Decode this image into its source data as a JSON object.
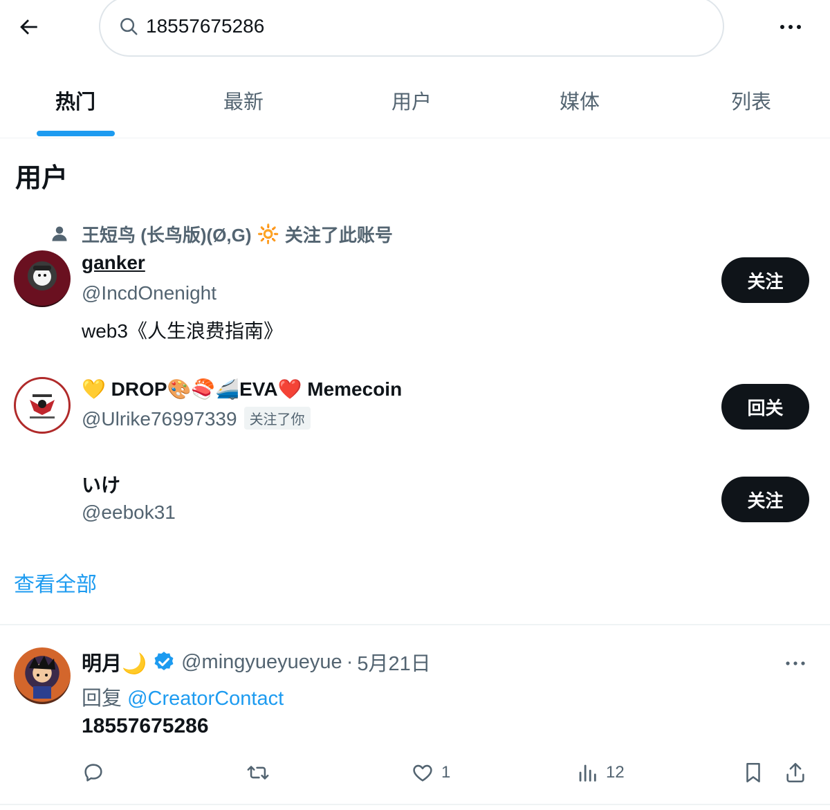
{
  "search": {
    "query": "18557675286"
  },
  "tabs": [
    {
      "label": "热门",
      "active": true
    },
    {
      "label": "最新",
      "active": false
    },
    {
      "label": "用户",
      "active": false
    },
    {
      "label": "媒体",
      "active": false
    },
    {
      "label": "列表",
      "active": false
    }
  ],
  "users_section": {
    "title": "用户",
    "social_context": {
      "prefix": "王短鸟 (长鸟版)(Ø,G)",
      "emoji": "🔆",
      "suffix": "关注了此账号"
    },
    "users": [
      {
        "name": "ganker",
        "handle": "@IncdOnenight",
        "bio": "web3《人生浪费指南》",
        "button": "关注",
        "follows_you": ""
      },
      {
        "name": "💛 DROP🎨🍣🚄EVA❤️ Memecoin",
        "handle": "@Ulrike76997339",
        "bio": "",
        "button": "回关",
        "follows_you": "关注了你"
      },
      {
        "name": "いけ",
        "handle": "@eebok31",
        "bio": "",
        "button": "关注",
        "follows_you": ""
      }
    ],
    "view_all": "查看全部"
  },
  "tweet": {
    "name": "明月🌙",
    "handle": "@mingyueyueyue",
    "separator": "·",
    "date": "5月21日",
    "reply_prefix": "回复",
    "reply_to": "@CreatorContact",
    "text": "18557675286",
    "likes": "1",
    "views": "12"
  },
  "colors": {
    "accent": "#1d9bf0",
    "text": "#0f1419",
    "secondary": "#536471",
    "button_bg": "#0f1419"
  },
  "icons": [
    "back-arrow-icon",
    "search-icon",
    "more-icon",
    "person-icon",
    "verified-badge-icon",
    "reply-icon",
    "retweet-icon",
    "like-icon",
    "views-icon",
    "bookmark-icon",
    "share-icon"
  ]
}
